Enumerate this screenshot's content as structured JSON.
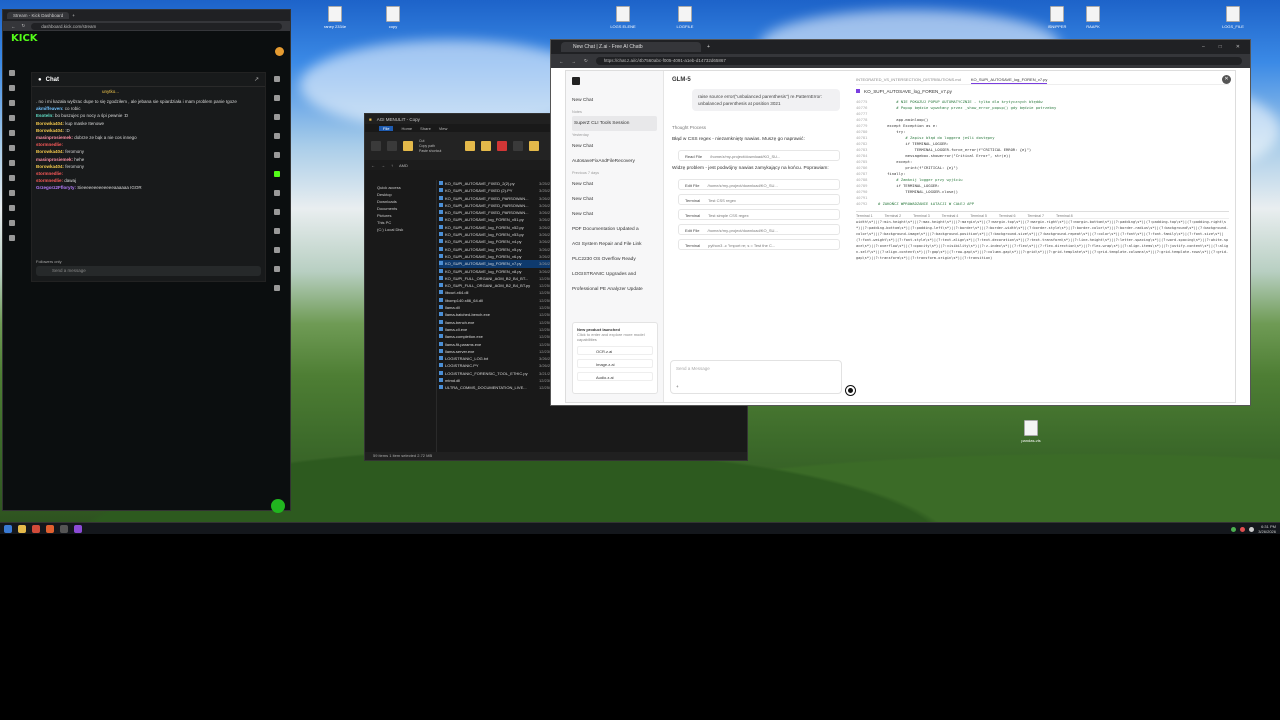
{
  "desktop": {
    "icons": [
      {
        "label": "raney 2334e"
      },
      {
        "label": "copy"
      },
      {
        "label": "LOGS ELENE"
      },
      {
        "label": "LOGFILE"
      },
      {
        "label": "ISNIPPER"
      },
      {
        "label": "RAAPK"
      },
      {
        "label": "LOGS_FILE"
      },
      {
        "label": "pandas-vis"
      }
    ]
  },
  "kick": {
    "tab_title": "Stream - Kick Dashboard",
    "url": "dashboard.kick.com/stream",
    "logo": "KICK",
    "chat_title": "Chat",
    "pinned": "unytko...",
    "messages": [
      {
        "user": "",
        "text": ". no i mi kazała wyłżrac dupe to się zgodziłem , ale jebana sie spiardziała i mam problem panie Igoze",
        "color": "#dddddd"
      },
      {
        "user": "akmiffeaven:",
        "text": "co robic",
        "color": "#6fc1ff"
      },
      {
        "user": "Esoteln:",
        "text": "bo buszujec po nocy a śpi pewnie :D",
        "color": "#61e0c7"
      },
      {
        "user": "Borowka404:",
        "text": "kup maske Itenowe",
        "color": "#f3c84c"
      },
      {
        "user": "Borowka404:",
        "text": ":D",
        "color": "#f3c84c"
      },
      {
        "user": "masinprosiemek:",
        "text": "dobrze ze bąk a nie cos innego",
        "color": "#ff8fa3"
      },
      {
        "user": "stormnedlie:",
        "text": "",
        "color": "#ff5a5a"
      },
      {
        "user": "Borowka404:",
        "text": "feromony",
        "color": "#f3c84c"
      },
      {
        "user": "masinprosiemek:",
        "text": "hehe",
        "color": "#ff8fa3"
      },
      {
        "user": "Borowka404:",
        "text": "feromony",
        "color": "#f3c84c"
      },
      {
        "user": "stormnedlie:",
        "text": "",
        "color": "#ff5a5a"
      },
      {
        "user": "stormnedlie:",
        "text": "dawaj",
        "color": "#ff5a5a"
      },
      {
        "user": "Grzegorz2Ffloryty:",
        "text": "Sieeeeeeeeeeeeeaaaaaa IGOR",
        "color": "#b77cff"
      }
    ],
    "followers_only": "Followers only",
    "input_placeholder": "Send a message"
  },
  "explorer": {
    "title": "AGI MENULIT - Copy",
    "menu": [
      "File",
      "Home",
      "Share",
      "View"
    ],
    "ribbon": [
      "Pin to Quick access",
      "Copy",
      "Paste",
      "Cut",
      "Copy path",
      "Paste shortcut",
      "Move to",
      "Copy to",
      "Delete",
      "Rename",
      "New folder"
    ],
    "group_labels": [
      "Clipboard",
      "Organize"
    ],
    "path": "AMD",
    "sidebar": [
      "Quick access",
      "Desktop",
      "Downloads",
      "Documents",
      "Pictures",
      "This PC",
      "(C:) Local Disk"
    ],
    "files": [
      {
        "name": "KO_SUPI_AUTOSAVE_FIXED_2(2).py",
        "date": "3/25/2",
        "type": "",
        "size": ""
      },
      {
        "name": "KO_SUPI_AUTOSAVE_FIXED (2).PY",
        "date": "3/25/2",
        "type": "",
        "size": ""
      },
      {
        "name": "KO_SUPI_AUTOSAVE_FIXED_PARSOWAN...",
        "date": "3/26/2",
        "type": "",
        "size": ""
      },
      {
        "name": "KO_SUPI_AUTOSAVE_FIXED_PARSOWAN...",
        "date": "3/26/2",
        "type": "",
        "size": ""
      },
      {
        "name": "KO_SUPI_AUTOSAVE_FIXED_PARSOWAN...",
        "date": "3/26/2",
        "type": "",
        "size": ""
      },
      {
        "name": "KO_SUPI_AUTOSAVE_log_FOREN_v51.py",
        "date": "3/26/2",
        "type": "",
        "size": ""
      },
      {
        "name": "KO_SUPI_AUTOSAVE_log_FOREN_v52.py",
        "date": "3/26/2",
        "type": "",
        "size": ""
      },
      {
        "name": "KO_SUPI_AUTOSAVE_log_FOREN_v53.py",
        "date": "3/26/2",
        "type": "",
        "size": ""
      },
      {
        "name": "KO_SUPI_AUTOSAVE_log_FOREN_v4.py",
        "date": "3/26/2",
        "type": "",
        "size": ""
      },
      {
        "name": "KO_SUPI_AUTOSAVE_log_FOREN_v5.py",
        "date": "3/26/2",
        "type": "",
        "size": ""
      },
      {
        "name": "KO_SUPI_AUTOSAVE_log_FOREN_v6.py",
        "date": "3/26/2",
        "type": "",
        "size": ""
      },
      {
        "name": "KO_SUPI_AUTOSAVE_log_FOREN_v7.py",
        "date": "3/26/2",
        "type": "",
        "size": "",
        "selected": true
      },
      {
        "name": "KO_SUPI_AUTOSAVE_log_FOREN_v8.py",
        "date": "3/26/2",
        "type": "",
        "size": ""
      },
      {
        "name": "KO_SUPI_FULL_ORGANI_AGM_B2_B4_BT...",
        "date": "12/25/",
        "type": "",
        "size": ""
      },
      {
        "name": "KO_SUPI_FULL_ORGANI_AGM_B2_B4_BT.py",
        "date": "12/25/",
        "type": "",
        "size": ""
      },
      {
        "name": "libcurl-x64.dll",
        "date": "12/25/",
        "type": "",
        "size": ""
      },
      {
        "name": "libomp140.x86_64.dll",
        "date": "12/25/",
        "type": "",
        "size": ""
      },
      {
        "name": "llama.dll",
        "date": "12/25/",
        "type": "",
        "size": ""
      },
      {
        "name": "llama-batched-bench.exe",
        "date": "12/25/",
        "type": "",
        "size": ""
      },
      {
        "name": "llama-bench.exe",
        "date": "12/25/",
        "type": "",
        "size": ""
      },
      {
        "name": "llama-cli.exe",
        "date": "12/25/",
        "type": "",
        "size": ""
      },
      {
        "name": "llama-completion.exe",
        "date": "12/25/",
        "type": "",
        "size": ""
      },
      {
        "name": "llama-fit-params.exe",
        "date": "12/25/",
        "type": "",
        "size": ""
      },
      {
        "name": "llama-server.exe",
        "date": "12/23/2025 9:51 PM",
        "type": "Application",
        "size": "7,378 KB"
      },
      {
        "name": "LOGISTRANIC_LOG.txt",
        "date": "3/26/2026 6:48 PM",
        "type": "Text Document",
        "size": "7 KB"
      },
      {
        "name": "LOGISTRANIC.PY",
        "date": "3/26/2026 5:52 AM",
        "type": "Python File",
        "size": "2,676 KB"
      },
      {
        "name": "LOGISTRANIC_FORENSIC_TOOL_ETHIC.py",
        "date": "3/21/2026 6:50 PM",
        "type": "Python File",
        "size": "3,409 KB"
      },
      {
        "name": "mtmd.dll",
        "date": "12/23/2025 9:51 PM",
        "type": "Application",
        "size": "1,424 KB"
      },
      {
        "name": "ULTRA_COMMS_DOCUMENTATION_LIVE...",
        "date": "12/25/2026 11:57 PM",
        "type": "MD File",
        "size": "38 KB"
      }
    ],
    "status": "59 items   1 item selected  2.72 MB"
  },
  "browser": {
    "tab_title": "New Chat | Z.ai - Free AI Chatb",
    "url": "https://chat.z.ai/c/4b7560abc-f005-4091-a1eb-d14732d65867",
    "sidebar": {
      "new_chat": "New Chat",
      "notes": "Notes",
      "active": "SuperZ CLI Tools Session",
      "yesterday": "Yesterday",
      "previous": "Previous 7 days",
      "items": [
        "New Chat",
        "AutosaveFixAndFileRecovery",
        "New Chat",
        "New Chat",
        "New Chat",
        "PDF Documentation Updated a",
        "AGI System Repair and File Link",
        "PLC2230 OS Overflow Ready",
        "LOGISTRANIC Upgrades and",
        "Professional PE Analyzer Update"
      ],
      "promo_title": "New product launched",
      "promo_text": "Click to enter and explore more model capabilities",
      "promo_items": [
        "OCR.z.ai",
        "Image.z.ai",
        "Audio.z.ai"
      ]
    },
    "chat": {
      "model": "GLM-5",
      "bubble": "raise source error(\"unbalanced parenthesis\") re.PatternError: unbalanced parenthesis at position 3021",
      "thought": "Thought Process",
      "para1": "Błąd w CSS regex - niezamknięty nawias. Muszę go naprawić:",
      "tool1": {
        "name": "Read File",
        "path": "/home/z/my-project/download/KO_SU..."
      },
      "para2": "Widzę problem - jest podwójny nawias zamykający na końcu. Poprawiam:",
      "tools": [
        {
          "name": "Edit File",
          "path": "/home/z/my-project/download/KO_SU..."
        },
        {
          "name": "Terminal",
          "path": "Test CSS regex"
        },
        {
          "name": "Terminal",
          "path": "Test simple CSS regex"
        },
        {
          "name": "Edit File",
          "path": "/home/z/my-project/download/KO_SU..."
        },
        {
          "name": "Terminal",
          "path": "python3 -c \"import re; s = Test the C..."
        }
      ],
      "placeholder": "Send a Message"
    },
    "code": {
      "tabs": [
        "INTEGRATED_VS_INTERSECTION_DISTRIBUTIONS.md",
        "KO_SUPI_AUTOSAVE_log_FOREN_v7.py"
      ],
      "file": "KO_SUPI_AUTOSAVE_log_FOREN_v7.py",
      "lines": [
        {
          "n": "40775",
          "t": "        # NIE POKAZUJ POPUP AUTOMATYCZNIE - tylko dla krytycznych błędów",
          "c": true
        },
        {
          "n": "40776",
          "t": "        # Popup będzie wywołany przez _show_error_popup() gdy będzie potrzebny",
          "c": true
        },
        {
          "n": "40777",
          "t": ""
        },
        {
          "n": "40778",
          "t": "        app.mainloop()",
          "c": false
        },
        {
          "n": "40779",
          "t": "    except Exception as e:",
          "c": false
        },
        {
          "n": "40780",
          "t": "        try:",
          "c": false
        },
        {
          "n": "40781",
          "t": "            # Zapisz błąd do loggera jeśli dostępny",
          "c": true
        },
        {
          "n": "40782",
          "t": "            if TERMINAL_LOGGER:",
          "c": false
        },
        {
          "n": "40783",
          "t": "                TERMINAL_LOGGER.force_error(f\"CRITICAL ERROR: {e}\")",
          "c": false
        },
        {
          "n": "40784",
          "t": "            messagebox.showerror(\"Critical Error\", str(e))",
          "c": false
        },
        {
          "n": "40785",
          "t": "        except:",
          "c": false
        },
        {
          "n": "40786",
          "t": "            print(f\"CRITICAL: {e}\")",
          "c": false
        },
        {
          "n": "40787",
          "t": "    finally:",
          "c": false
        },
        {
          "n": "40788",
          "t": "        # Zamknij logger przy wyjściu",
          "c": true
        },
        {
          "n": "40789",
          "t": "        if TERMINAL_LOGGER:",
          "c": false
        },
        {
          "n": "40790",
          "t": "            TERMINAL_LOGGER.close()",
          "c": false
        },
        {
          "n": "40791",
          "t": ""
        },
        {
          "n": "40792",
          "t": "# ZAKOŃCZ WPROWADZANIE ŁATACJI W CAŁEJ APP",
          "c": true
        }
      ],
      "term_tabs": [
        "Terminal 1",
        "Terminal 2",
        "Terminal 3",
        "Terminal 4",
        "Terminal 5",
        "Terminal 6",
        "Terminal 7",
        "Terminal 8"
      ],
      "term": "width\\s*)|(?:min-height\\s*)|(?:max-height\\s*)|(?:margin\\s*)|(?:margin-top\\s*)|(?:margin-right\\s*)|(?:margin-bottom\\s*)|(?:padding\\s*)|(?:padding-top\\s*)|(?:padding-right\\s*)|(?:padding-bottom\\s*)|(?:padding-left\\s*)|(?:border\\s*)|(?:border-width\\s*)|(?:border-style\\s*)|(?:border-color\\s*)|(?:border-radius\\s*)|(?:background\\s*)|(?:background-color\\s*)|(?:background-image\\s*)|(?:background-position\\s*)|(?:background-size\\s*)|(?:background-repeat\\s*)|(?:color\\s*)|(?:font\\s*)|(?:font-family\\s*)|(?:font-size\\s*)|(?:font-weight\\s*)|(?:font-style\\s*)|(?:text-align\\s*)|(?:text-decoration\\s*)|(?:text-transform\\s*)|(?:line-height\\s*)|(?:letter-spacing\\s*)|(?:word-spacing\\s*)|(?:white-space\\s*)|(?:overflow\\s*)|(?:opacity\\s*)|(?:visibility\\s*)|(?:z-index\\s*)|(?:flex\\s*)|(?:flex-direction\\s*)|(?:flex-wrap\\s*)|(?:align-items\\s*)|(?:justify-content\\s*)|(?:align-self\\s*)|(?:align-content\\s*)|(?:gap\\s*)|(?:row-gap\\s*)|(?:column-gap\\s*)|(?:grid\\s*)|(?:grid-template\\s*)|(?:grid-template-columns\\s*)|(?:grid-template-rows\\s*)|(?:grid-gap\\s*)|(?:transform\\s*)|(?:transform-origin\\s*)|(?:transition)"
    }
  },
  "taskbar": {
    "time": "6:31 PM",
    "date": "3/26/2026"
  }
}
